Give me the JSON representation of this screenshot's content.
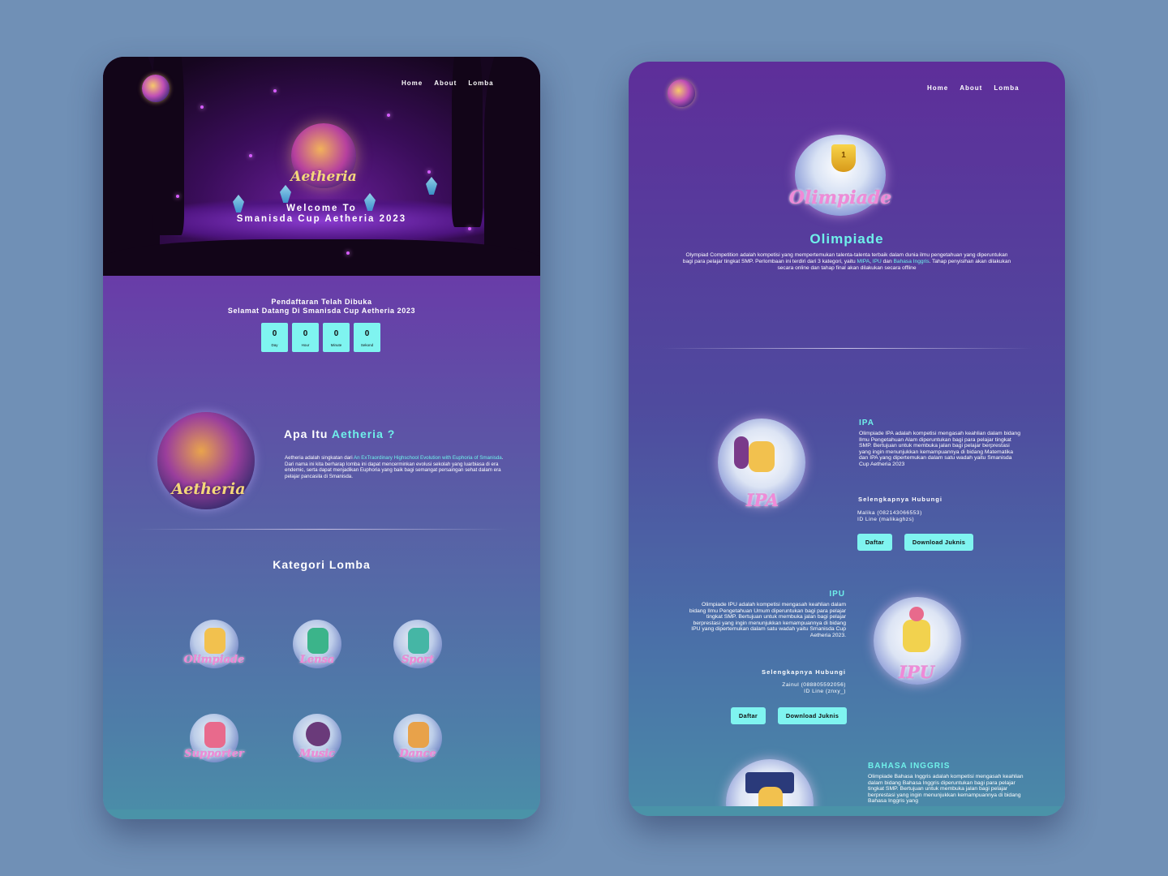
{
  "left": {
    "nav": {
      "home": "Home",
      "about": "About",
      "lomba": "Lomba"
    },
    "hero": {
      "emblem_text": "Aetheria",
      "title_line1": "Welcome To",
      "title_line2": "Smanisda Cup Aetheria 2023"
    },
    "registration": {
      "line1": "Pendaftaran Telah Dibuka",
      "line2": "Selamat Datang Di Smanisda Cup Aetheria 2023"
    },
    "countdown": [
      {
        "value": "0",
        "label": "Day"
      },
      {
        "value": "0",
        "label": "Hour"
      },
      {
        "value": "0",
        "label": "Minute"
      },
      {
        "value": "0",
        "label": "Sekond"
      }
    ],
    "about": {
      "art_text": "Aetheria",
      "title_prefix": "Apa Itu",
      "title_accent": "Aetheria ?",
      "text_prefix": "Aetheria adalah singkatan dari",
      "text_accent": "An ExTraordinary Highschool Evolution with Euphoria of Smanisda",
      "text_suffix": ". Dari nama ini kita berharap lomba ini dapat mencerminkan evolusi sekolah yang luarbiasa di era endemic, serta dapat menjadikan Euphoria yang baik bagi semangat persaingan sehat dalam era pelajar pancasila di Smanisda."
    },
    "kategori": {
      "title": "Kategori Lomba",
      "items": [
        {
          "name": "Olimpiade",
          "color": "#f2c14e"
        },
        {
          "name": "Lensa",
          "color": "#3bb48a"
        },
        {
          "name": "Sport",
          "color": "#45b6a5"
        },
        {
          "name": "Supporter",
          "color": "#e86a8c"
        },
        {
          "name": "Music",
          "color": "#6a3a7a"
        },
        {
          "name": "Dance",
          "color": "#e8a24a"
        }
      ]
    }
  },
  "right": {
    "nav": {
      "home": "Home",
      "about": "About",
      "lomba": "Lomba"
    },
    "olimpiade": {
      "art_text": "Olimpiade",
      "trophy_number": "1",
      "title": "Olimpiade",
      "desc_part1": "Olympiad Competition adalah kompetisi yang mempertemukan talenta-talenta terbaik dalam dunia ilmu pengetahuan yang diperuntukan bagi para pelajar tingkat SMP. Perlombaan ini terdiri dari 3 kategori, yaitu",
      "desc_mipa": "MIPA",
      "desc_sep1": ",",
      "desc_ipu": "IPU",
      "desc_dan": "dan",
      "desc_bing": "Bahasa Inggris",
      "desc_part2": ". Tahap penyisihan akan dilakukan secara online dan tahap final akan dilakukan secara offline"
    },
    "ipa": {
      "art_text": "IPA",
      "title": "IPA",
      "desc": "Olimpiade IPA adalah kompetisi mengasah keahlian dalam bidang Ilmu Pengetahuan Alam diperuntukan bagi para pelajar tingkat SMP. Bertujuan untuk membuka jalan bagi pelajar berprestasi yang ingin menunjukkan kemampuannya di bidang Matematika dan IPA yang dipertemukan dalam satu wadah yaitu Smanisda Cup Aetheria 2023",
      "contact_heading": "Selengkapnya Hubungi",
      "contact_name": "Malika (082143066553)",
      "contact_line": "ID Line (malikaghzs)",
      "btn_daftar": "Daftar",
      "btn_juknis": "Download Juknis"
    },
    "ipu": {
      "art_text": "IPU",
      "title": "IPU",
      "desc": "Olimpiade IPU adalah kompetisi mengasah keahlian dalam bidang Ilmu Pengetahuan Umum diperuntukan bagi para pelajar tingkat SMP. Bertujuan untuk membuka jalan bagi pelajar berprestasi yang ingin menunjukkan kemampuannya di bidang IPU yang dipertemukan dalam satu wadah yaitu Smanisda Cup Aetheria 2023.",
      "contact_heading": "Selengkapnya Hubungi",
      "contact_name": "Zainul (088805592056)",
      "contact_line": "ID Line (znxy_)",
      "btn_daftar": "Daftar",
      "btn_juknis": "Download Juknis"
    },
    "bing": {
      "title": "BAHASA INGGRIS",
      "desc": "Olimpiade Bahasa Inggris adalah kompetisi mengasah keahlian dalam bidang Bahasa Inggris diperuntukan bagi para pelajar tingkat SMP. Bertujuan untuk membuka jalan bagi pelajar berprestasi yang ingin menunjukkan kemampuannya di bidang Bahasa Inggris yang"
    }
  },
  "colors": {
    "accent": "#6ff0ea",
    "button": "#7ff4f0",
    "background": "#7090b6"
  }
}
